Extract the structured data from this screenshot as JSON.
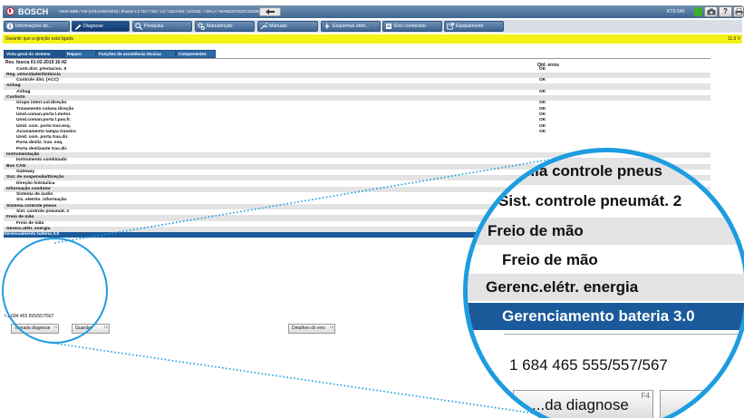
{
  "titlebar": {
    "brand": "BOSCH",
    "vehicle": "VWW 4968 / VW (VOLKSWAGEN) / Sharan 2.0 TDI / 7N2 / 2.0 / 110.0 kW / 11/2015 - / DFLA / WVWZZZ7NZGV226393",
    "device": "KTS 540"
  },
  "tabs": [
    {
      "label": "Informações do..."
    },
    {
      "label": "Diagnose"
    },
    {
      "label": "Pesquisa"
    },
    {
      "label": "Manutenção"
    },
    {
      "label": "Manuais"
    },
    {
      "label": "Esquemas elétr..."
    },
    {
      "label": "Erro conhecido"
    },
    {
      "label": "Equipamento"
    }
  ],
  "status": {
    "message": "Garantir que a ignição está ligada",
    "voltage": "11,6 V"
  },
  "subtabs": [
    "Vista geral do sistema",
    "Reparo",
    "Funções de assistência técnica",
    "Componentes"
  ],
  "results": {
    "date": "Res. busca  01-02-2019  16:42",
    "column": "Qtd. erros",
    "rows": [
      {
        "type": "item",
        "label": "Contr.dist. p/estacion. II",
        "value": "OK"
      },
      {
        "type": "grp",
        "label": "Reg. velocidade/distância",
        "value": ""
      },
      {
        "type": "item",
        "label": "Controle dist. (ACC)",
        "value": "OK"
      },
      {
        "type": "grp",
        "label": "Airbag",
        "value": ""
      },
      {
        "type": "item",
        "label": "Airbag",
        "value": "OK"
      },
      {
        "type": "grp",
        "label": "Conforto",
        "value": ""
      },
      {
        "type": "item",
        "label": "Grupo interr.col.direção",
        "value": "OK"
      },
      {
        "type": "item",
        "label": "Travamento coluna direção",
        "value": "OK"
      },
      {
        "type": "item",
        "label": "Unid.coman.porta l.motor.",
        "value": "OK"
      },
      {
        "type": "item",
        "label": "Unid.coman.porta l.pas.fr.",
        "value": "OK"
      },
      {
        "type": "item",
        "label": "Unid. com. porta tras.esq.",
        "value": "OK"
      },
      {
        "type": "item",
        "label": "Acionamento tampa traseira",
        "value": "OK"
      },
      {
        "type": "item",
        "label": "Unid. com. porta tras.dir.",
        "value": ""
      },
      {
        "type": "item",
        "label": "Porta desliz. tras. esq.",
        "value": ""
      },
      {
        "type": "item",
        "label": "Porta deslizante tras.dir.",
        "value": ""
      },
      {
        "type": "grp",
        "label": "Instrumentação",
        "value": ""
      },
      {
        "type": "item",
        "label": "Instrumento combinado",
        "value": ""
      },
      {
        "type": "grp",
        "label": "Bus CAN",
        "value": ""
      },
      {
        "type": "item",
        "label": "Gateway",
        "value": ""
      },
      {
        "type": "grp",
        "label": "Sist. de suspensão/Direção",
        "value": ""
      },
      {
        "type": "item",
        "label": "Direção hidráulica",
        "value": ""
      },
      {
        "type": "grp",
        "label": "Informação condutor",
        "value": ""
      },
      {
        "type": "item",
        "label": "Sistema de áudio",
        "value": ""
      },
      {
        "type": "item",
        "label": "Sis. eletrôn. informação",
        "value": ""
      },
      {
        "type": "grp",
        "label": "Sistema controle pneus",
        "value": ""
      },
      {
        "type": "item",
        "label": "Sist. controle pneumát. 2",
        "value": ""
      },
      {
        "type": "grp",
        "label": "Freio de mão",
        "value": ""
      },
      {
        "type": "item",
        "label": "Freio de mão",
        "value": ""
      },
      {
        "type": "grp",
        "label": "Gerenc.elétr. energia",
        "value": ""
      },
      {
        "type": "selected",
        "label": "Gerenciamento bateria 3.0",
        "value": ""
      }
    ]
  },
  "footer": {
    "partno": "1 684 465 555/557/567",
    "buttons": [
      {
        "label": "Tomada diagnose",
        "fkey": "F4"
      },
      {
        "label": "Guardar",
        "fkey": "F5"
      },
      {
        "label": "Detalhes do erro",
        "fkey": "F8"
      }
    ]
  },
  "magnifier": {
    "rows": [
      {
        "type": "grp",
        "label": "...ia controle pneus"
      },
      {
        "type": "item",
        "label": "Sist. controle pneumát. 2"
      },
      {
        "type": "grp",
        "label": "Freio de mão"
      },
      {
        "type": "item",
        "label": "Freio de mão"
      },
      {
        "type": "grp",
        "label": "Gerenc.elétr. energia"
      },
      {
        "type": "sel",
        "label": "Gerenciamento bateria 3.0"
      }
    ],
    "partno": "1 684 465 555/557/567",
    "button": "...da diagnose",
    "fkey": "F4"
  },
  "colors": {
    "accent": "#1d9ce0",
    "header_blue": "#3f6791",
    "status_yellow": "#f5f215",
    "selected_row": "#1a5a9a"
  }
}
